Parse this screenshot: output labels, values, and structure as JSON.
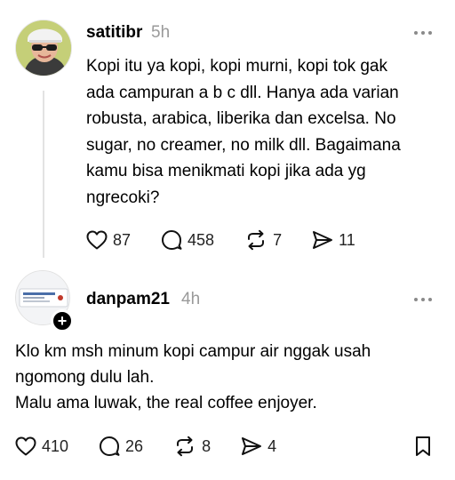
{
  "post1": {
    "username": "satitibr",
    "time": "5h",
    "text": "Kopi itu ya kopi, kopi murni, kopi tok gak\nada campuran a b c dll. Hanya ada varian\nrobusta, arabica, liberika dan excelsa. No\nsugar, no creamer, no milk dll. Bagaimana\nkamu bisa menikmati kopi jika ada yg\nngrecoki?",
    "likes": "87",
    "replies": "458",
    "reposts": "7",
    "shares": "11"
  },
  "post2": {
    "username": "danpam21",
    "time": "4h",
    "text": "Klo km msh minum kopi campur air nggak usah\nngomong dulu lah.\nMalu ama luwak, the real coffee enjoyer.",
    "likes": "410",
    "replies": "26",
    "reposts": "8",
    "shares": "4",
    "follow_badge": "+"
  },
  "icons": {
    "like": "heart-icon",
    "reply": "speech-bubble-icon",
    "repost": "repost-arrows-icon",
    "share": "send-icon",
    "more": "more-dots-icon",
    "bookmark": "bookmark-icon"
  }
}
